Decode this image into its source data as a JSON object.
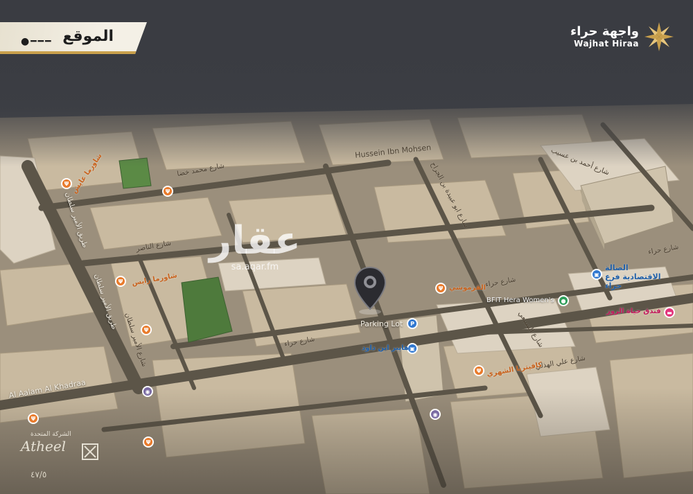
{
  "title": {
    "text": "الموقع"
  },
  "brand": {
    "arabic": "واجهة حراء",
    "english": "Wajhat Hiraa",
    "color": "#c9a04c"
  },
  "watermark": {
    "arabic": "عقار",
    "url": "sa.aqar.fm"
  },
  "footer_brand": {
    "small": "الشركة المتحدة",
    "name": "Atheel",
    "page": "٤٧/٥"
  },
  "map": {
    "streets": [
      "شارع أحمد بن عسيب",
      "شارع حراء",
      "شارع حراء",
      "شارع حراء",
      "طريق الأمير سلطان",
      "طريق الأمير سلطان",
      "شارع الأمير سلطان",
      "شارع علي الهذلي",
      "شارع السبيعي",
      "شارع ابو عبيدة بن الجراح",
      "شارع محمد خضا",
      "شارع الناصر",
      "Hussein Ibn Mohsen",
      "Al Aalam Al Khadraa"
    ],
    "pois": [
      {
        "name": "Parking Lot",
        "icon": "parking-icon",
        "color": "#2f77d0"
      },
      {
        "name": "BFIT Hera Women's",
        "icon": "fitness-icon",
        "color": "#2f9e5a"
      },
      {
        "name": "الصالة الاقتصادية فرع حراء",
        "icon": "shopping-icon",
        "color": "#2f77d0"
      },
      {
        "name": "فندق حياة الروز",
        "icon": "hotel-icon",
        "color": "#e2337b"
      },
      {
        "name": "القرموشي",
        "icon": "restaurant-icon",
        "color": "#e97b2c"
      },
      {
        "name": "هايبر ابن داود",
        "icon": "shopping-icon",
        "color": "#2f77d0"
      },
      {
        "name": "شاورما رايس",
        "icon": "restaurant-icon",
        "color": "#e97b2c"
      },
      {
        "name": "شاورما عايش",
        "icon": "restaurant-icon",
        "color": "#e97b2c"
      },
      {
        "name": "كافيتريا الشهري",
        "icon": "restaurant-icon",
        "color": "#e97b2c"
      }
    ]
  }
}
